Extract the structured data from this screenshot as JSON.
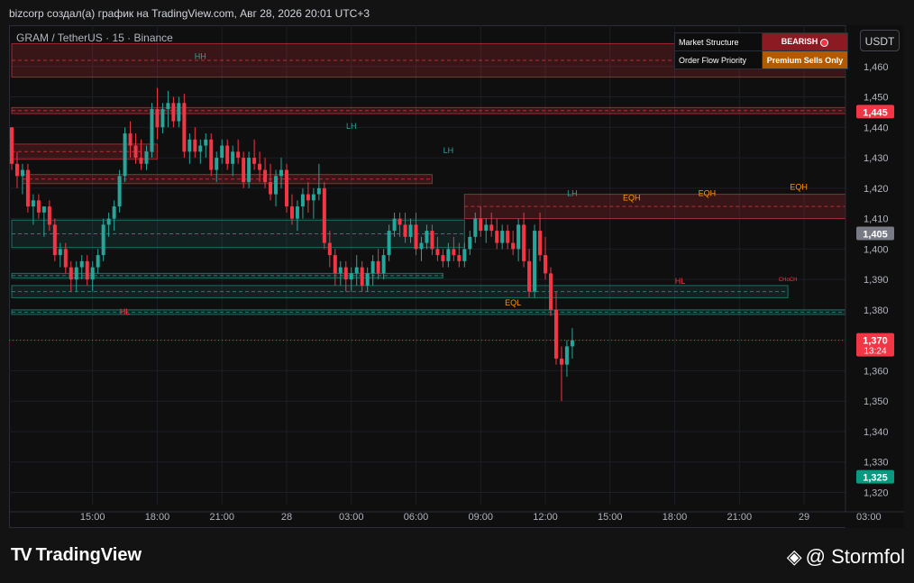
{
  "header": {
    "caption": "bizcorp создал(а) график на TradingView.com, Авг 28, 2026 20:01 UTC+3"
  },
  "symbol_line": "GRAM / TetherUS · 15 · Binance",
  "currency_button": "USDT",
  "info_table": {
    "row1_label": "Market Structure",
    "row1_value": "BEARISH",
    "row2_label": "Order Flow Priority",
    "row2_value": "Premium Sells Only"
  },
  "footer": {
    "brand": "TradingView",
    "author": "@ Stormfol",
    "brand_icon": "tradingview-logo-icon",
    "author_icon": "binance-diamond-icon"
  },
  "colors": {
    "up": "#26a69a",
    "down": "#f23645",
    "background": "#0f0f0f"
  },
  "chart_data": {
    "type": "candlestick",
    "ylim": [
      1.316,
      1.47
    ],
    "y_ticks": [
      1.32,
      1.33,
      1.34,
      1.35,
      1.36,
      1.37,
      1.38,
      1.39,
      1.4,
      1.41,
      1.42,
      1.43,
      1.44,
      1.45,
      1.46
    ],
    "y_tick_labels": [
      "1,320",
      "1,330",
      "1,340",
      "1,350",
      "1,360",
      "1,370",
      "1,380",
      "1,390",
      "1,400",
      "1,410",
      "1,420",
      "1,430",
      "1,440",
      "1,450",
      "1,460"
    ],
    "x_ticks": [
      {
        "label": "15:00",
        "idx": 15
      },
      {
        "label": "18:00",
        "idx": 27
      },
      {
        "label": "21:00",
        "idx": 39
      },
      {
        "label": "28",
        "idx": 51
      },
      {
        "label": "03:00",
        "idx": 63
      },
      {
        "label": "06:00",
        "idx": 75
      },
      {
        "label": "09:00",
        "idx": 87
      },
      {
        "label": "12:00",
        "idx": 99
      },
      {
        "label": "15:00",
        "idx": 111
      },
      {
        "label": "18:00",
        "idx": 123
      },
      {
        "label": "21:00",
        "idx": 135
      },
      {
        "label": "29",
        "idx": 147
      },
      {
        "label": "03:00",
        "idx": 159
      }
    ],
    "candles_ohlc": [
      [
        1.44,
        1.44,
        1.426,
        1.428
      ],
      [
        1.428,
        1.432,
        1.42,
        1.424
      ],
      [
        1.424,
        1.428,
        1.418,
        1.426
      ],
      [
        1.426,
        1.428,
        1.412,
        1.414
      ],
      [
        1.414,
        1.418,
        1.408,
        1.416
      ],
      [
        1.416,
        1.418,
        1.41,
        1.412
      ],
      [
        1.412,
        1.414,
        1.404,
        1.414
      ],
      [
        1.414,
        1.416,
        1.406,
        1.408
      ],
      [
        1.408,
        1.41,
        1.396,
        1.398
      ],
      [
        1.398,
        1.402,
        1.394,
        1.4
      ],
      [
        1.4,
        1.402,
        1.392,
        1.394
      ],
      [
        1.394,
        1.396,
        1.386,
        1.39
      ],
      [
        1.39,
        1.396,
        1.386,
        1.394
      ],
      [
        1.394,
        1.398,
        1.39,
        1.396
      ],
      [
        1.396,
        1.398,
        1.388,
        1.39
      ],
      [
        1.39,
        1.396,
        1.386,
        1.394
      ],
      [
        1.394,
        1.4,
        1.392,
        1.398
      ],
      [
        1.398,
        1.41,
        1.396,
        1.408
      ],
      [
        1.408,
        1.412,
        1.404,
        1.41
      ],
      [
        1.41,
        1.416,
        1.406,
        1.414
      ],
      [
        1.414,
        1.426,
        1.412,
        1.424
      ],
      [
        1.424,
        1.44,
        1.422,
        1.438
      ],
      [
        1.438,
        1.442,
        1.43,
        1.434
      ],
      [
        1.434,
        1.438,
        1.428,
        1.43
      ],
      [
        1.43,
        1.436,
        1.426,
        1.428
      ],
      [
        1.428,
        1.434,
        1.426,
        1.432
      ],
      [
        1.432,
        1.448,
        1.43,
        1.446
      ],
      [
        1.446,
        1.453,
        1.436,
        1.44
      ],
      [
        1.44,
        1.448,
        1.438,
        1.446
      ],
      [
        1.446,
        1.452,
        1.44,
        1.448
      ],
      [
        1.448,
        1.45,
        1.44,
        1.442
      ],
      [
        1.442,
        1.45,
        1.44,
        1.448
      ],
      [
        1.448,
        1.451,
        1.43,
        1.432
      ],
      [
        1.432,
        1.438,
        1.428,
        1.436
      ],
      [
        1.436,
        1.44,
        1.43,
        1.432
      ],
      [
        1.432,
        1.436,
        1.428,
        1.434
      ],
      [
        1.434,
        1.438,
        1.43,
        1.436
      ],
      [
        1.436,
        1.438,
        1.424,
        1.426
      ],
      [
        1.426,
        1.432,
        1.422,
        1.43
      ],
      [
        1.43,
        1.436,
        1.428,
        1.434
      ],
      [
        1.434,
        1.436,
        1.426,
        1.428
      ],
      [
        1.428,
        1.434,
        1.424,
        1.432
      ],
      [
        1.432,
        1.436,
        1.428,
        1.43
      ],
      [
        1.43,
        1.432,
        1.42,
        1.422
      ],
      [
        1.422,
        1.432,
        1.42,
        1.43
      ],
      [
        1.43,
        1.436,
        1.426,
        1.428
      ],
      [
        1.428,
        1.432,
        1.422,
        1.426
      ],
      [
        1.426,
        1.43,
        1.42,
        1.422
      ],
      [
        1.422,
        1.428,
        1.416,
        1.418
      ],
      [
        1.418,
        1.426,
        1.414,
        1.424
      ],
      [
        1.424,
        1.43,
        1.42,
        1.426
      ],
      [
        1.426,
        1.428,
        1.412,
        1.414
      ],
      [
        1.414,
        1.418,
        1.408,
        1.41
      ],
      [
        1.41,
        1.416,
        1.406,
        1.414
      ],
      [
        1.414,
        1.42,
        1.41,
        1.418
      ],
      [
        1.418,
        1.422,
        1.412,
        1.416
      ],
      [
        1.416,
        1.42,
        1.41,
        1.418
      ],
      [
        1.418,
        1.428,
        1.416,
        1.42
      ],
      [
        1.42,
        1.422,
        1.4,
        1.402
      ],
      [
        1.402,
        1.406,
        1.394,
        1.398
      ],
      [
        1.398,
        1.4,
        1.388,
        1.392
      ],
      [
        1.392,
        1.396,
        1.388,
        1.394
      ],
      [
        1.394,
        1.396,
        1.386,
        1.39
      ],
      [
        1.39,
        1.394,
        1.386,
        1.392
      ],
      [
        1.392,
        1.398,
        1.388,
        1.394
      ],
      [
        1.394,
        1.396,
        1.386,
        1.388
      ],
      [
        1.388,
        1.394,
        1.386,
        1.392
      ],
      [
        1.392,
        1.398,
        1.388,
        1.396
      ],
      [
        1.396,
        1.4,
        1.39,
        1.392
      ],
      [
        1.392,
        1.4,
        1.39,
        1.398
      ],
      [
        1.398,
        1.408,
        1.396,
        1.406
      ],
      [
        1.406,
        1.412,
        1.404,
        1.41
      ],
      [
        1.41,
        1.412,
        1.404,
        1.408
      ],
      [
        1.408,
        1.412,
        1.402,
        1.404
      ],
      [
        1.404,
        1.41,
        1.402,
        1.408
      ],
      [
        1.408,
        1.412,
        1.398,
        1.4
      ],
      [
        1.4,
        1.404,
        1.396,
        1.402
      ],
      [
        1.402,
        1.408,
        1.4,
        1.406
      ],
      [
        1.406,
        1.408,
        1.398,
        1.4
      ],
      [
        1.4,
        1.404,
        1.396,
        1.398
      ],
      [
        1.398,
        1.4,
        1.394,
        1.396
      ],
      [
        1.396,
        1.402,
        1.394,
        1.4
      ],
      [
        1.4,
        1.404,
        1.396,
        1.398
      ],
      [
        1.398,
        1.402,
        1.394,
        1.396
      ],
      [
        1.396,
        1.402,
        1.394,
        1.4
      ],
      [
        1.4,
        1.406,
        1.398,
        1.404
      ],
      [
        1.404,
        1.412,
        1.402,
        1.41
      ],
      [
        1.41,
        1.414,
        1.404,
        1.406
      ],
      [
        1.406,
        1.41,
        1.402,
        1.408
      ],
      [
        1.408,
        1.412,
        1.404,
        1.406
      ],
      [
        1.406,
        1.41,
        1.4,
        1.402
      ],
      [
        1.402,
        1.408,
        1.4,
        1.406
      ],
      [
        1.406,
        1.408,
        1.4,
        1.402
      ],
      [
        1.402,
        1.406,
        1.398,
        1.4
      ],
      [
        1.4,
        1.41,
        1.396,
        1.408
      ],
      [
        1.408,
        1.412,
        1.394,
        1.396
      ],
      [
        1.396,
        1.4,
        1.384,
        1.386
      ],
      [
        1.386,
        1.408,
        1.384,
        1.406
      ],
      [
        1.406,
        1.412,
        1.396,
        1.398
      ],
      [
        1.398,
        1.404,
        1.39,
        1.392
      ],
      [
        1.392,
        1.394,
        1.378,
        1.38
      ],
      [
        1.38,
        1.386,
        1.362,
        1.364
      ],
      [
        1.364,
        1.368,
        1.35,
        1.362
      ],
      [
        1.362,
        1.37,
        1.358,
        1.368
      ],
      [
        1.368,
        1.374,
        1.364,
        1.37
      ]
    ],
    "zones": [
      {
        "kind": "supply",
        "y1": 1.4565,
        "y2": 1.4675,
        "x0": 0,
        "x1": 162,
        "label": ""
      },
      {
        "kind": "supply",
        "y1": 1.4445,
        "y2": 1.4465,
        "x0": 0,
        "x1": 162,
        "label": ""
      },
      {
        "kind": "supply",
        "y1": 1.4295,
        "y2": 1.4345,
        "x0": 0,
        "x1": 27,
        "label": ""
      },
      {
        "kind": "supply",
        "y1": 1.4215,
        "y2": 1.4245,
        "x0": 2,
        "x1": 78,
        "label": ""
      },
      {
        "kind": "supply",
        "y1": 1.41,
        "y2": 1.418,
        "x0": 84,
        "x1": 162,
        "label": ""
      },
      {
        "kind": "demand",
        "y1": 1.3905,
        "y2": 1.392,
        "x0": 0,
        "x1": 80,
        "label": ""
      },
      {
        "kind": "demand",
        "y1": 1.4005,
        "y2": 1.4095,
        "x0": 0,
        "x1": 84,
        "label": ""
      },
      {
        "kind": "demand",
        "y1": 1.384,
        "y2": 1.388,
        "x0": 0,
        "x1": 144,
        "label": ""
      },
      {
        "kind": "demand",
        "y1": 1.3785,
        "y2": 1.38,
        "x0": 0,
        "x1": 156,
        "label": ""
      }
    ],
    "labels": [
      {
        "text": "HH",
        "x": 35,
        "y": 1.4625,
        "color": "#26a69a"
      },
      {
        "text": "LH",
        "x": 63,
        "y": 1.4395,
        "color": "#26a69a"
      },
      {
        "text": "LH",
        "x": 81,
        "y": 1.4315,
        "color": "#26a69a"
      },
      {
        "text": "LH",
        "x": 104,
        "y": 1.4175,
        "color": "#26a69a"
      },
      {
        "text": "EQH",
        "x": 115,
        "y": 1.416,
        "color": "#ff9800"
      },
      {
        "text": "EQH",
        "x": 129,
        "y": 1.4175,
        "color": "#ff9800"
      },
      {
        "text": "EQH",
        "x": 146,
        "y": 1.4195,
        "color": "#ff9800"
      },
      {
        "text": "EQL",
        "x": 93,
        "y": 1.3815,
        "color": "#ff9800"
      },
      {
        "text": "HL",
        "x": 21,
        "y": 1.3785,
        "color": "#f23645"
      },
      {
        "text": "HL",
        "x": 124,
        "y": 1.3885,
        "color": "#f23645"
      },
      {
        "text": "CHoCH",
        "x": 144,
        "y": 1.3895,
        "color": "#f23645"
      }
    ],
    "position": {
      "entry": 1.405,
      "target": 1.325,
      "stop": 1.445,
      "x0": 162,
      "x1": 193
    },
    "last_price": 1.37,
    "price_tags": [
      {
        "value": 1.445,
        "text": "1,445",
        "color": "#f23645"
      },
      {
        "value": 1.405,
        "text": "1,405",
        "color": "#787b86"
      },
      {
        "value": 1.37,
        "text": "1,370",
        "sub": "13:24",
        "color": "#f23645"
      },
      {
        "value": 1.325,
        "text": "1,325",
        "color": "#089981"
      }
    ]
  }
}
